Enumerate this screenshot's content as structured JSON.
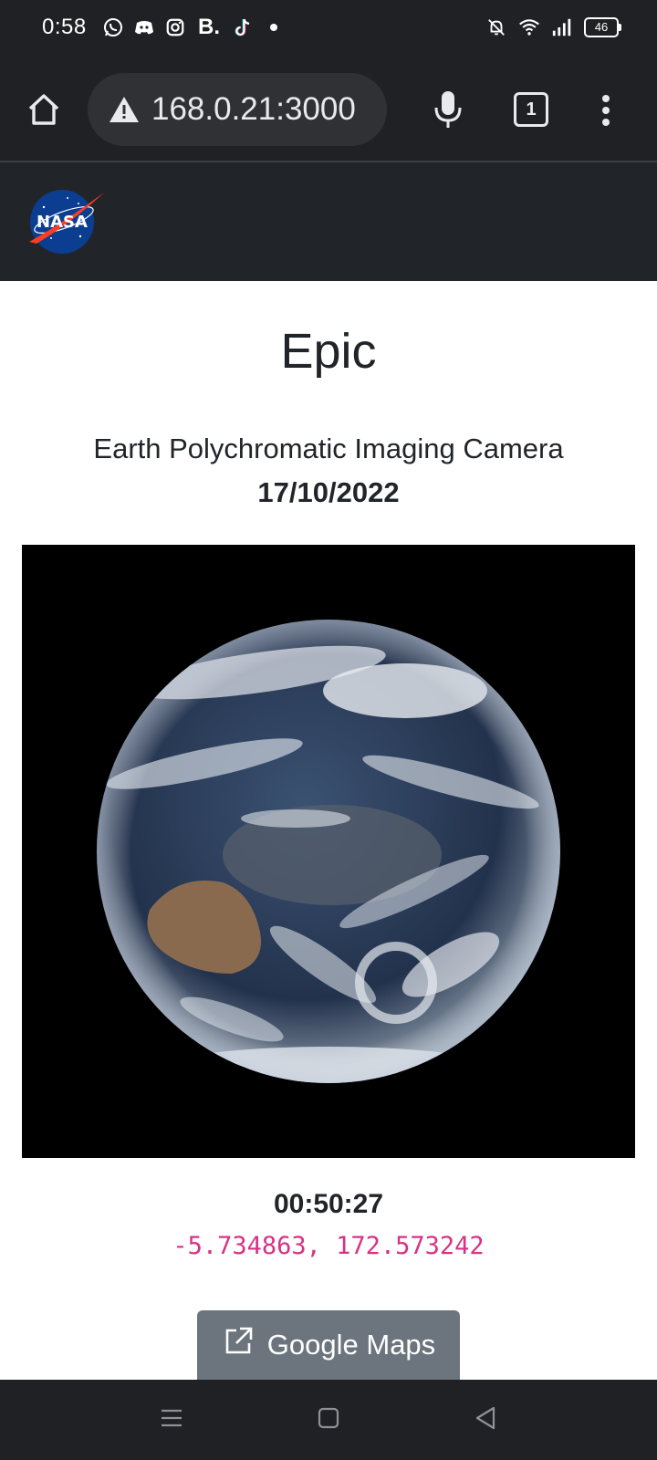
{
  "status_bar": {
    "time": "0:58",
    "battery": "46",
    "left_icons": [
      "whatsapp-icon",
      "discord-icon",
      "instagram-icon",
      "b-dot-icon",
      "tiktok-icon",
      "dot-icon"
    ],
    "b_label": "B.",
    "right_icons": [
      "bell-off-icon",
      "wifi-icon",
      "signal-icon",
      "battery-icon"
    ]
  },
  "browser": {
    "url": "168.0.21:3000",
    "tab_count": "1",
    "icons": [
      "home-icon",
      "warning-icon",
      "mic-icon",
      "tabs-icon",
      "more-vert-icon"
    ]
  },
  "navbar": {
    "logo_text": "NASA"
  },
  "main": {
    "title": "Epic",
    "subtitle": "Earth Polychromatic Imaging Camera",
    "date": "17/10/2022",
    "time": "00:50:27",
    "coordinates": "-5.734863, 172.573242",
    "maps_button_label": "Google Maps"
  },
  "colors": {
    "bar_bg": "#202124",
    "navbar_bg": "#212529",
    "coords_color": "#d63384",
    "button_bg": "#6c757d"
  },
  "android_nav": {
    "icons": [
      "menu-icon",
      "home-square-icon",
      "back-icon"
    ]
  }
}
